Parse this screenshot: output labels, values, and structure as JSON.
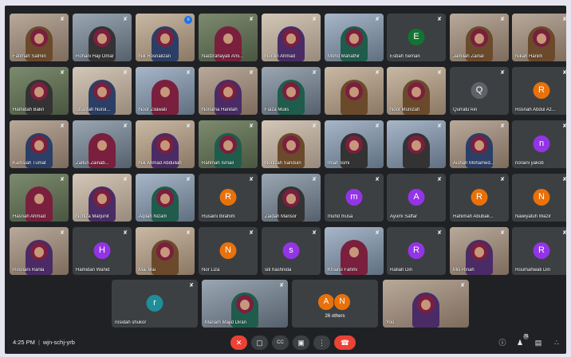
{
  "tiles": [
    {
      "name": "Fatimah Salmin",
      "video": true
    },
    {
      "name": "Rohani Haji Omar",
      "video": true
    },
    {
      "name": "Nik Rosnalizan",
      "video": true,
      "speaking": true
    },
    {
      "name": "Nadzrahayati Ami...",
      "video": true
    },
    {
      "name": "Nordin Ahmad",
      "video": true
    },
    {
      "name": "Mohd Mahathir",
      "video": true
    },
    {
      "name": "Esbah Seman",
      "video": false,
      "initial": "E",
      "color": "#137333"
    },
    {
      "name": "Jamilah Zainal",
      "video": true
    },
    {
      "name": "Nikah Hanim",
      "video": true
    },
    {
      "name": "Hamidah Bakri",
      "video": true
    },
    {
      "name": "Sharifah Nurul...",
      "video": true
    },
    {
      "name": "Noor Zilawati",
      "video": true
    },
    {
      "name": "Norsima Hanitah",
      "video": true
    },
    {
      "name": "Faiza Mulis",
      "video": true
    },
    {
      "name": "",
      "video": true
    },
    {
      "name": "Noor Munizah",
      "video": true
    },
    {
      "name": "Qurratu'Ain",
      "video": false,
      "initial": "Q",
      "color": "#5f6368"
    },
    {
      "name": "Rosnah Abdul Az...",
      "video": false,
      "initial": "R",
      "color": "#e8710a"
    },
    {
      "name": "Kamsiah Tumat",
      "video": true
    },
    {
      "name": "Zaitun Zainab...",
      "video": true
    },
    {
      "name": "Nik Ahmad Abdullah",
      "video": true
    },
    {
      "name": "Rahmah Ismail",
      "video": true
    },
    {
      "name": "Norlizah Sariduin",
      "video": true
    },
    {
      "name": "Imah Iismi",
      "video": true
    },
    {
      "name": "",
      "video": true
    },
    {
      "name": "Aishah Mohamed...",
      "video": true
    },
    {
      "name": "noraini yakob",
      "video": false,
      "initial": "n",
      "color": "#9334e6"
    },
    {
      "name": "Hasnah Ahmad",
      "video": true
    },
    {
      "name": "Norliza Marjunit",
      "video": true
    },
    {
      "name": "Aqilah Nizam",
      "video": true
    },
    {
      "name": "Rusaini Ibrahim",
      "video": false,
      "initial": "R",
      "color": "#e8710a"
    },
    {
      "name": "Zaidah Mansor",
      "video": true
    },
    {
      "name": "muhd musa",
      "video": false,
      "initial": "m",
      "color": "#9334e6"
    },
    {
      "name": "Ayumi Saffar",
      "video": false,
      "initial": "A",
      "color": "#9334e6"
    },
    {
      "name": "Rahimah Abubak...",
      "video": false,
      "initial": "R",
      "color": "#e8710a"
    },
    {
      "name": "Nawiyatuh Wazir",
      "video": false,
      "initial": "N",
      "color": "#e8710a"
    },
    {
      "name": "Rosnani Ranla",
      "video": true
    },
    {
      "name": "Hamidan Wahid",
      "video": false,
      "initial": "H",
      "color": "#9334e6"
    },
    {
      "name": "Mai Mai",
      "video": true
    },
    {
      "name": "Nor Liza",
      "video": false,
      "initial": "N",
      "color": "#e8710a"
    },
    {
      "name": "siti hashnida",
      "video": false,
      "initial": "s",
      "color": "#9334e6"
    },
    {
      "name": "Khairul Fahmi",
      "video": true
    },
    {
      "name": "Rafiah Din",
      "video": false,
      "initial": "R",
      "color": "#9334e6"
    },
    {
      "name": "Mis Rinah",
      "video": true
    },
    {
      "name": "Roumahwati Din",
      "video": false,
      "initial": "R",
      "color": "#9334e6"
    }
  ],
  "bottom_tiles": [
    {
      "name": "rosidah shukor",
      "video": false,
      "initial": "r",
      "color": "#1e8e9a"
    },
    {
      "name": "Mariam Majid Diran",
      "video": true
    },
    {
      "name": "26 others",
      "others": true,
      "initials": [
        "A",
        "N"
      ],
      "colors": [
        "#e8710a",
        "#e8710a"
      ]
    },
    {
      "name": "You",
      "video": true
    }
  ],
  "status": {
    "time": "4:25 PM",
    "meeting_code": "wjn-schj-yrb"
  },
  "controls": {
    "mic": "✕",
    "camera": "▢",
    "captions": "CC",
    "present": "▣",
    "more": "⋮",
    "leave": "☎"
  },
  "side": {
    "info": "ⓘ",
    "people": "♟",
    "people_count": "76",
    "chat": "▤",
    "activities": "∴"
  }
}
